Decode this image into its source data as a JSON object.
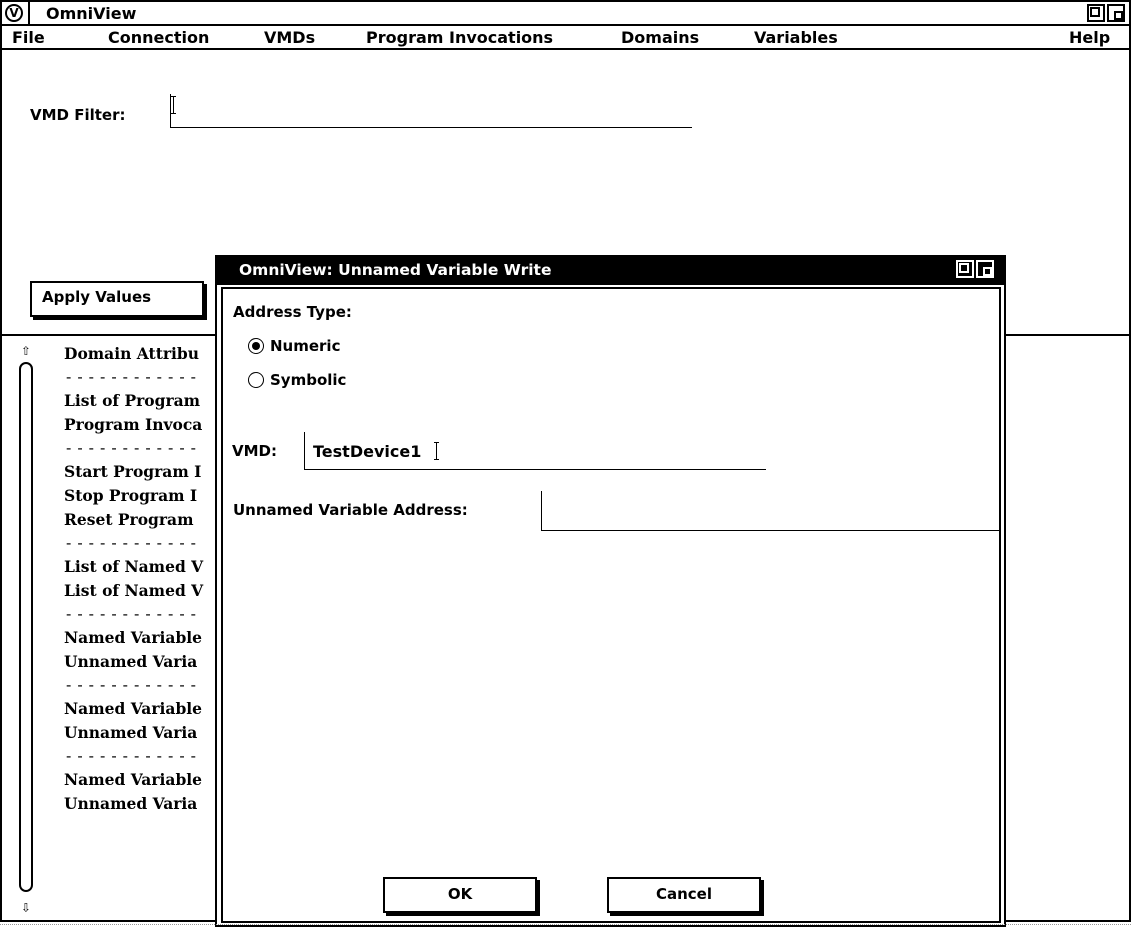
{
  "main_window": {
    "title": "OmniView",
    "menu": [
      "File",
      "Connection",
      "VMDs",
      "Program Invocations",
      "Domains",
      "Variables",
      "Help"
    ],
    "vmd_filter_label": "VMD Filter:",
    "vmd_filter_value": "",
    "apply_button": "Apply Values",
    "list_items": [
      "Domain Attribu",
      "------------",
      "List of Program",
      "Program Invoca",
      "------------",
      "Start Program I",
      "Stop Program I",
      "Reset Program",
      "------------",
      "List of Named V",
      "List of Named V",
      "------------",
      "Named Variable",
      "Unnamed Varia",
      "------------",
      "Named Variable",
      "Unnamed Varia",
      "------------",
      "Named Variable",
      "Unnamed Varia"
    ]
  },
  "dialog": {
    "title": "OmniView: Unnamed Variable Write",
    "address_type_label": "Address Type:",
    "address_type_options": [
      "Numeric",
      "Symbolic"
    ],
    "address_type_selected": "Numeric",
    "vmd_label": "VMD:",
    "vmd_value": "TestDevice1",
    "unnamed_address_label": "Unnamed Variable Address:",
    "unnamed_address_value": "",
    "ok_button": "OK",
    "cancel_button": "Cancel"
  }
}
